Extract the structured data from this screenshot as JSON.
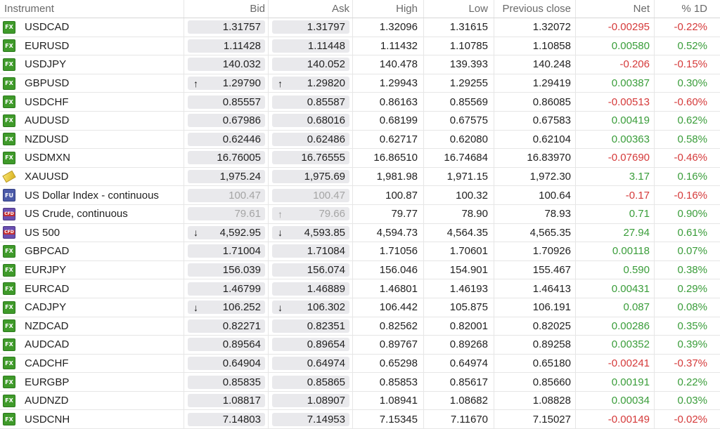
{
  "header": {
    "instrument": "Instrument",
    "bid": "Bid",
    "ask": "Ask",
    "high": "High",
    "low": "Low",
    "prev_close": "Previous close",
    "net": "Net",
    "pct": "% 1D"
  },
  "rows": [
    {
      "type": "FX",
      "name": "USDCAD",
      "bid": "1.31757",
      "ask": "1.31797",
      "high": "1.32096",
      "low": "1.31615",
      "prev": "1.32072",
      "net": "-0.00295",
      "pct": "-0.22%",
      "dir": "neg"
    },
    {
      "type": "FX",
      "name": "EURUSD",
      "bid": "1.11428",
      "ask": "1.11448",
      "high": "1.11432",
      "low": "1.10785",
      "prev": "1.10858",
      "net": "0.00580",
      "pct": "0.52%",
      "dir": "pos"
    },
    {
      "type": "FX",
      "name": "USDJPY",
      "bid": "140.032",
      "ask": "140.052",
      "high": "140.478",
      "low": "139.393",
      "prev": "140.248",
      "net": "-0.206",
      "pct": "-0.15%",
      "dir": "neg"
    },
    {
      "type": "FX",
      "name": "GBPUSD",
      "bid": "1.29790",
      "ask": "1.29820",
      "high": "1.29943",
      "low": "1.29255",
      "prev": "1.29419",
      "net": "0.00387",
      "pct": "0.30%",
      "dir": "pos",
      "bid_arrow": "↑",
      "ask_arrow": "↑"
    },
    {
      "type": "FX",
      "name": "USDCHF",
      "bid": "0.85557",
      "ask": "0.85587",
      "high": "0.86163",
      "low": "0.85569",
      "prev": "0.86085",
      "net": "-0.00513",
      "pct": "-0.60%",
      "dir": "neg"
    },
    {
      "type": "FX",
      "name": "AUDUSD",
      "bid": "0.67986",
      "ask": "0.68016",
      "high": "0.68199",
      "low": "0.67575",
      "prev": "0.67583",
      "net": "0.00419",
      "pct": "0.62%",
      "dir": "pos"
    },
    {
      "type": "FX",
      "name": "NZDUSD",
      "bid": "0.62446",
      "ask": "0.62486",
      "high": "0.62717",
      "low": "0.62080",
      "prev": "0.62104",
      "net": "0.00363",
      "pct": "0.58%",
      "dir": "pos"
    },
    {
      "type": "FX",
      "name": "USDMXN",
      "bid": "16.76005",
      "ask": "16.76555",
      "high": "16.86510",
      "low": "16.74684",
      "prev": "16.83970",
      "net": "-0.07690",
      "pct": "-0.46%",
      "dir": "neg"
    },
    {
      "type": "GOLD",
      "name": "XAUUSD",
      "bid": "1,975.24",
      "ask": "1,975.69",
      "high": "1,981.98",
      "low": "1,971.15",
      "prev": "1,972.30",
      "net": "3.17",
      "pct": "0.16%",
      "dir": "pos"
    },
    {
      "type": "FU",
      "name": "US Dollar Index - continuous",
      "bid": "100.47",
      "ask": "100.47",
      "high": "100.87",
      "low": "100.32",
      "prev": "100.64",
      "net": "-0.17",
      "pct": "-0.16%",
      "dir": "neg",
      "dim": true
    },
    {
      "type": "CFD",
      "name": "US Crude, continuous",
      "bid": "79.61",
      "ask": "79.66",
      "high": "79.77",
      "low": "78.90",
      "prev": "78.93",
      "net": "0.71",
      "pct": "0.90%",
      "dir": "pos",
      "dim": true,
      "ask_arrow": "↑",
      "ask_arrow_gray": true
    },
    {
      "type": "CFD",
      "name": "US 500",
      "bid": "4,592.95",
      "ask": "4,593.85",
      "high": "4,594.73",
      "low": "4,564.35",
      "prev": "4,565.35",
      "net": "27.94",
      "pct": "0.61%",
      "dir": "pos",
      "bid_arrow": "↓",
      "ask_arrow": "↓"
    },
    {
      "type": "FX",
      "name": "GBPCAD",
      "bid": "1.71004",
      "ask": "1.71084",
      "high": "1.71056",
      "low": "1.70601",
      "prev": "1.70926",
      "net": "0.00118",
      "pct": "0.07%",
      "dir": "pos"
    },
    {
      "type": "FX",
      "name": "EURJPY",
      "bid": "156.039",
      "ask": "156.074",
      "high": "156.046",
      "low": "154.901",
      "prev": "155.467",
      "net": "0.590",
      "pct": "0.38%",
      "dir": "pos"
    },
    {
      "type": "FX",
      "name": "EURCAD",
      "bid": "1.46799",
      "ask": "1.46889",
      "high": "1.46801",
      "low": "1.46193",
      "prev": "1.46413",
      "net": "0.00431",
      "pct": "0.29%",
      "dir": "pos"
    },
    {
      "type": "FX",
      "name": "CADJPY",
      "bid": "106.252",
      "ask": "106.302",
      "high": "106.442",
      "low": "105.875",
      "prev": "106.191",
      "net": "0.087",
      "pct": "0.08%",
      "dir": "pos",
      "bid_arrow": "↓",
      "ask_arrow": "↓"
    },
    {
      "type": "FX",
      "name": "NZDCAD",
      "bid": "0.82271",
      "ask": "0.82351",
      "high": "0.82562",
      "low": "0.82001",
      "prev": "0.82025",
      "net": "0.00286",
      "pct": "0.35%",
      "dir": "pos"
    },
    {
      "type": "FX",
      "name": "AUDCAD",
      "bid": "0.89564",
      "ask": "0.89654",
      "high": "0.89767",
      "low": "0.89268",
      "prev": "0.89258",
      "net": "0.00352",
      "pct": "0.39%",
      "dir": "pos"
    },
    {
      "type": "FX",
      "name": "CADCHF",
      "bid": "0.64904",
      "ask": "0.64974",
      "high": "0.65298",
      "low": "0.64974",
      "prev": "0.65180",
      "net": "-0.00241",
      "pct": "-0.37%",
      "dir": "neg"
    },
    {
      "type": "FX",
      "name": "EURGBP",
      "bid": "0.85835",
      "ask": "0.85865",
      "high": "0.85853",
      "low": "0.85617",
      "prev": "0.85660",
      "net": "0.00191",
      "pct": "0.22%",
      "dir": "pos"
    },
    {
      "type": "FX",
      "name": "AUDNZD",
      "bid": "1.08817",
      "ask": "1.08907",
      "high": "1.08941",
      "low": "1.08682",
      "prev": "1.08828",
      "net": "0.00034",
      "pct": "0.03%",
      "dir": "pos"
    },
    {
      "type": "FX",
      "name": "USDCNH",
      "bid": "7.14803",
      "ask": "7.14953",
      "high": "7.15345",
      "low": "7.11670",
      "prev": "7.15027",
      "net": "-0.00149",
      "pct": "-0.02%",
      "dir": "neg"
    }
  ],
  "colors": {
    "positive": "#3a9d3a",
    "negative": "#d53a3a",
    "fx_badge": "#3f9a2a",
    "cfd_badge": "#6b4fb0",
    "fu_badge": "#4b5aa8"
  },
  "icons": {
    "FX": "fx-badge-icon",
    "FU": "futures-badge-icon",
    "CFD": "cfd-badge-icon",
    "GOLD": "gold-bar-icon",
    "up": "up-arrow-icon",
    "down": "down-arrow-icon"
  }
}
